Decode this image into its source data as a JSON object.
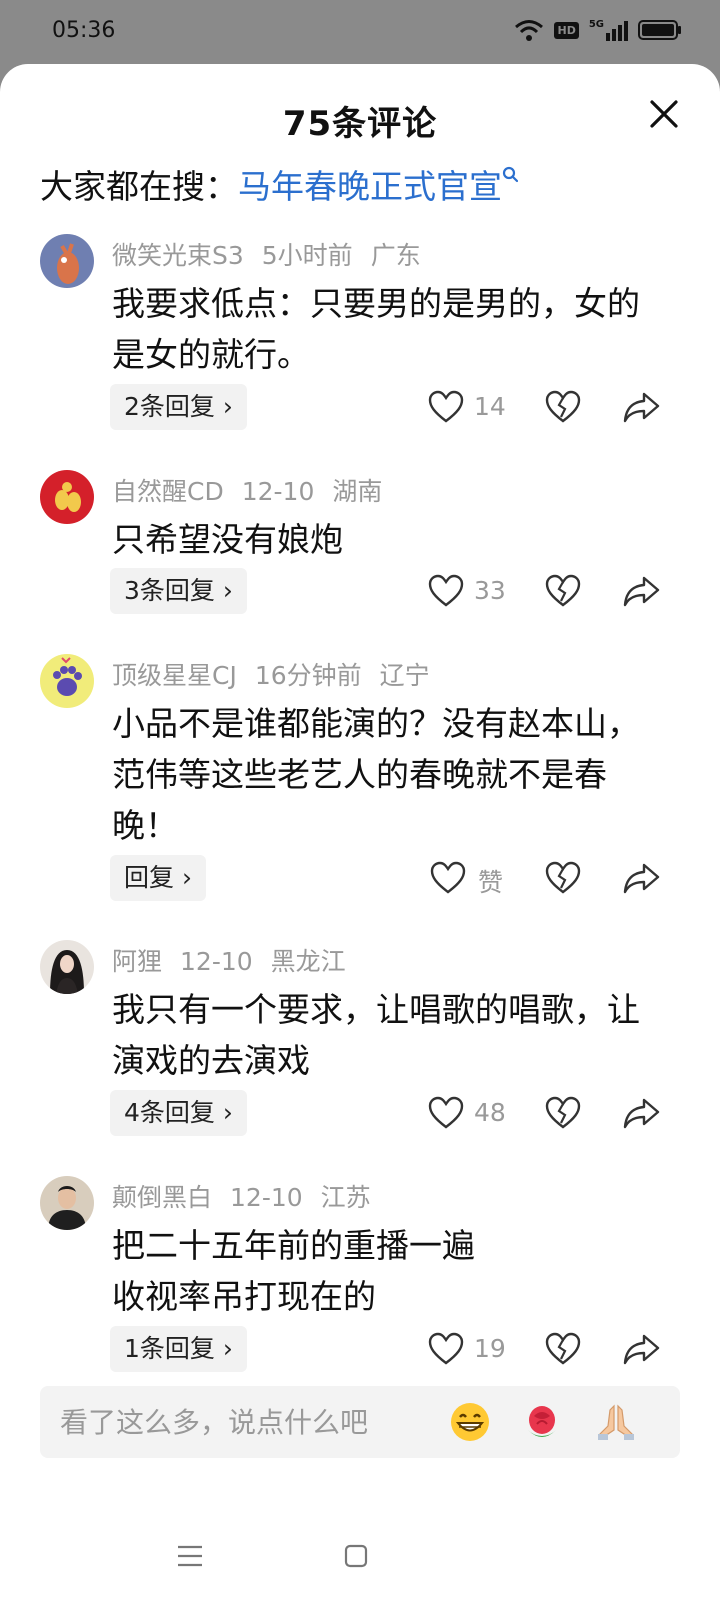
{
  "status_bar": {
    "time": "05:36",
    "network_badge": "HD",
    "signal_label": "5G"
  },
  "header": {
    "title": "75条评论"
  },
  "search": {
    "prefix": "大家都在搜：",
    "query": "马年春晚正式官宣"
  },
  "comments": [
    {
      "user": "微笑光束S3",
      "time": "5小时前",
      "location": "广东",
      "text": "我要求低点：只要男的是男的，女的是女的就行。",
      "reply_label": "2条回复 ›",
      "likes": "14"
    },
    {
      "user": "自然醒CD",
      "time": "12-10",
      "location": "湖南",
      "text": "只希望没有娘炮",
      "reply_label": "3条回复 ›",
      "likes": "33"
    },
    {
      "user": "顶级星星CJ",
      "time": "16分钟前",
      "location": "辽宁",
      "text": "小品不是谁都能演的？没有赵本山，范伟等这些老艺人的春晚就不是春晚！",
      "reply_label": "回复 ›",
      "likes": "赞"
    },
    {
      "user": "阿狸",
      "time": "12-10",
      "location": "黑龙江",
      "text": "我只有一个要求，让唱歌的唱歌，让演戏的去演戏",
      "reply_label": "4条回复 ›",
      "likes": "48"
    },
    {
      "user": "颠倒黑白",
      "time": "12-10",
      "location": "江苏",
      "text": "把二十五年前的重播一遍\n收视率吊打现在的",
      "reply_label": "1条回复 ›",
      "likes": "19"
    }
  ],
  "input": {
    "placeholder": "看了这么多，说点什么吧"
  },
  "emojis": [
    "grin-emoji",
    "rose-emoji",
    "pray-emoji"
  ],
  "colors": {
    "accent": "#2b6fce",
    "muted": "#999999",
    "sheet": "#ffffff",
    "status_bg": "#8a8a8a"
  }
}
